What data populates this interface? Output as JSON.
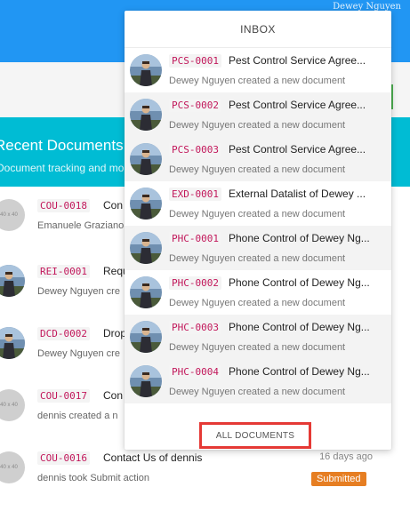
{
  "header": {
    "user_name": "Dewey Nguyen"
  },
  "recent": {
    "title": "Recent Documents",
    "subtitle": "Document tracking and moni",
    "items": [
      {
        "code": "COU-0018",
        "title": "Con",
        "subtitle": "Emanuele Graziano",
        "avatar": "placeholder"
      },
      {
        "code": "REI-0001",
        "title": "Requ",
        "subtitle": "Dewey Nguyen cre",
        "avatar": "photo"
      },
      {
        "code": "DCD-0002",
        "title": "Drop",
        "subtitle": "Dewey Nguyen cre",
        "avatar": "photo"
      },
      {
        "code": "COU-0017",
        "title": "Con",
        "subtitle": "dennis created a n",
        "avatar": "placeholder"
      },
      {
        "code": "COU-0016",
        "title": "Contact Us of dennis",
        "subtitle": "dennis took Submit action",
        "time": "16 days ago",
        "status": "Submitted",
        "avatar": "placeholder"
      }
    ]
  },
  "inbox": {
    "title": "INBOX",
    "items": [
      {
        "code": "PCS-0001",
        "title": "Pest Control Service Agree...",
        "subtitle": "Dewey Nguyen created a new document"
      },
      {
        "code": "PCS-0002",
        "title": "Pest Control Service Agree...",
        "subtitle": "Dewey Nguyen created a new document"
      },
      {
        "code": "PCS-0003",
        "title": "Pest Control Service Agree...",
        "subtitle": "Dewey Nguyen created a new document"
      },
      {
        "code": "EXD-0001",
        "title": "External Datalist of Dewey ...",
        "subtitle": "Dewey Nguyen created a new document"
      },
      {
        "code": "PHC-0001",
        "title": "Phone Control of Dewey Ng...",
        "subtitle": "Dewey Nguyen created a new document"
      },
      {
        "code": "PHC-0002",
        "title": "Phone Control of Dewey Ng...",
        "subtitle": "Dewey Nguyen created a new document"
      },
      {
        "code": "PHC-0003",
        "title": "Phone Control of Dewey Ng...",
        "subtitle": "Dewey Nguyen created a new document"
      },
      {
        "code": "PHC-0004",
        "title": "Phone Control of Dewey Ng...",
        "subtitle": "Dewey Nguyen created a new document"
      }
    ],
    "all_documents_label": "ALL DOCUMENTS"
  },
  "colors": {
    "topbar": "#2196f3",
    "card_header": "#00bcd4",
    "status": "#e67e22",
    "highlight": "#e53935",
    "code_text": "#c2185b"
  }
}
